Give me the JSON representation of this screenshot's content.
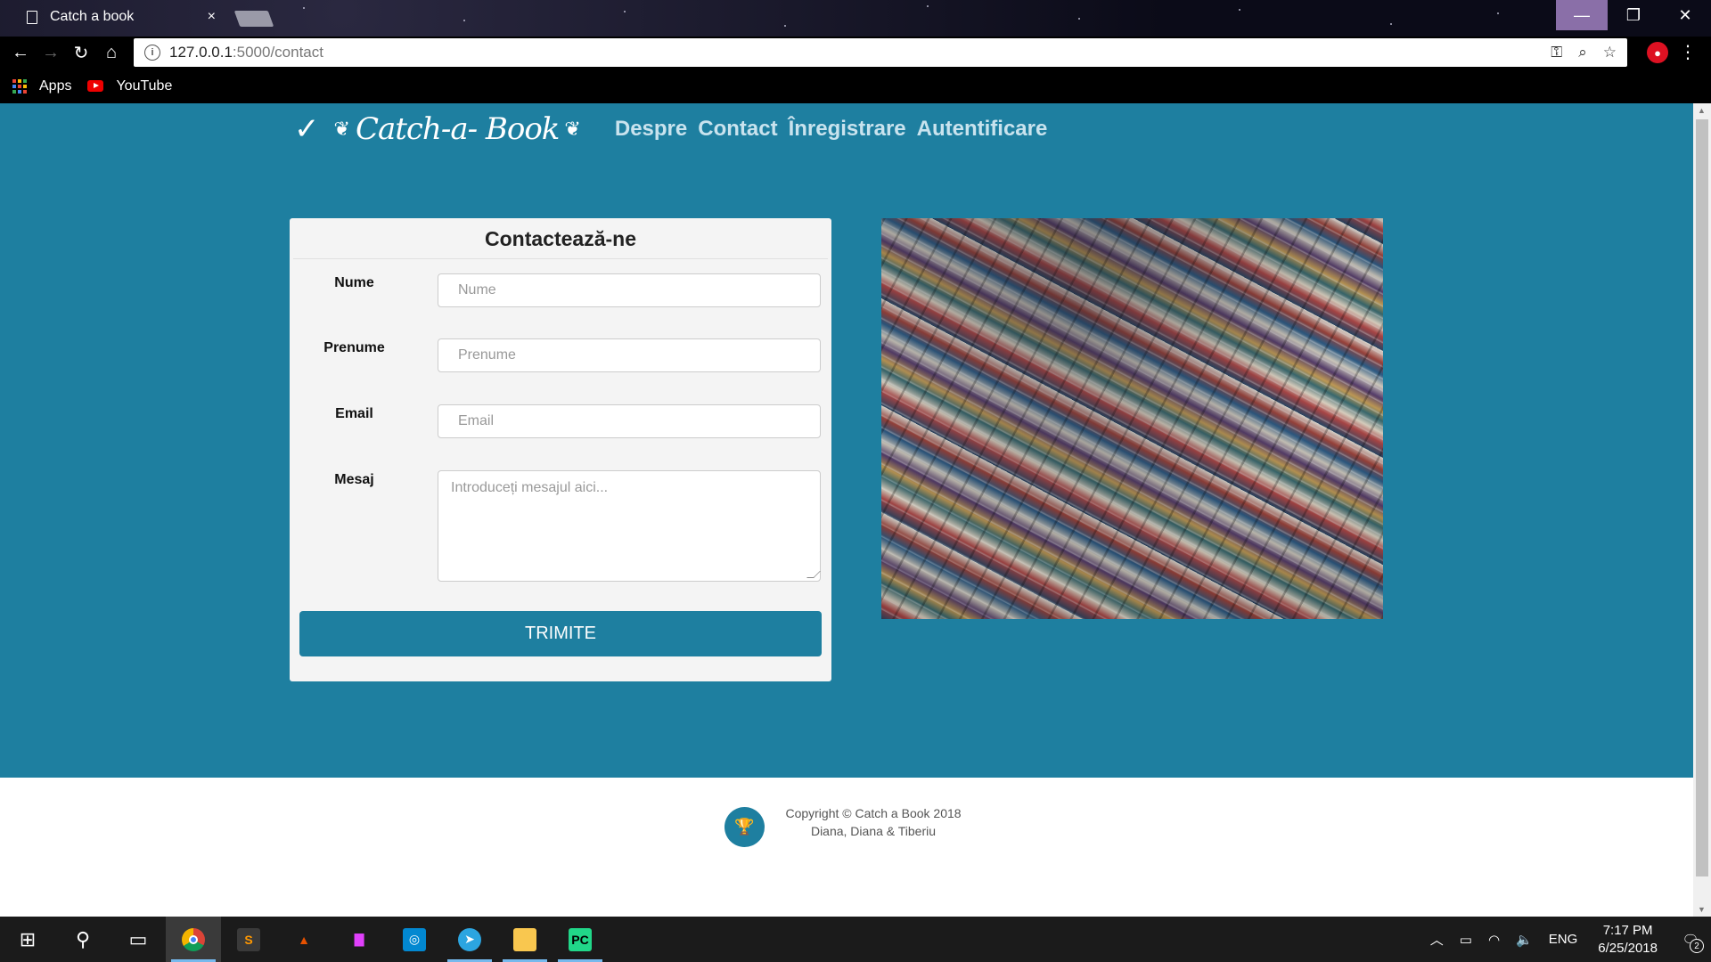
{
  "browser": {
    "tab_title": "Catch a book",
    "tab_close": "×",
    "window_min": "—",
    "window_max": "❐",
    "window_close": "✕",
    "url_host": "127.0.0.1",
    "url_path": ":5000/contact",
    "bookmarks": [
      {
        "label": "Apps",
        "icon": "apps-grid-icon"
      },
      {
        "label": "YouTube",
        "icon": "youtube-icon"
      }
    ]
  },
  "site": {
    "logo_text": "Catch-a- Book",
    "nav": [
      "Despre",
      "Contact",
      "Înregistrare",
      "Autentificare"
    ]
  },
  "form": {
    "title": "Contactează-ne",
    "fields": [
      {
        "label": "Nume",
        "placeholder": "Nume"
      },
      {
        "label": "Prenume",
        "placeholder": "Prenume"
      },
      {
        "label": "Email",
        "placeholder": "Email"
      },
      {
        "label": "Mesaj",
        "placeholder": "Introduceți mesajul aici..."
      }
    ],
    "submit_label": "TRIMITE"
  },
  "footer": {
    "copyright": "Copyright © Catch a Book 2018",
    "authors": "Diana, Diana & Tiberiu"
  },
  "taskbar": {
    "language": "ENG",
    "time": "7:17 PM",
    "date": "6/25/2018",
    "notification_count": "2"
  },
  "colors": {
    "brand": "#1e7fa0",
    "card": "#f4f4f4",
    "taskbar": "#1b1b1b"
  }
}
